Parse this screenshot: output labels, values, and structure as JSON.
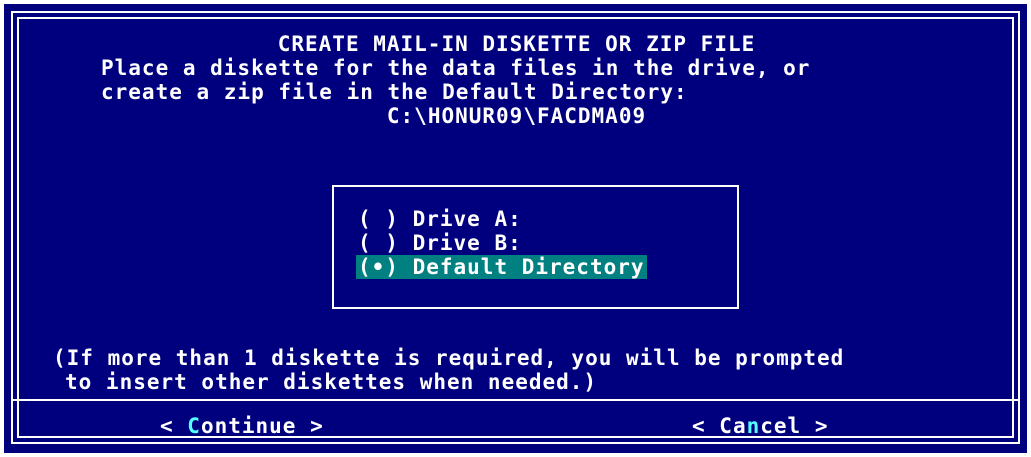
{
  "dialog": {
    "title": "CREATE MAIL-IN DISKETTE OR ZIP FILE",
    "instruction_line1": "Place a diskette for the data files in the drive, or",
    "instruction_line2": "create a zip file in the Default Directory:",
    "default_directory": "C:\\HONUR09\\FACDMA09",
    "options": [
      {
        "marker": "( )",
        "label": "Drive A:",
        "selected": false
      },
      {
        "marker": "( )",
        "label": "Drive B:",
        "selected": false
      },
      {
        "marker": "(•)",
        "label": "Default Directory",
        "selected": true
      }
    ],
    "note_line1": "(If more than 1 diskette is required, you will be prompted",
    "note_line2": "to insert other diskettes when needed.)"
  },
  "buttons": {
    "continue": {
      "open": "< ",
      "pre": "",
      "hotkey": "C",
      "post": "ontinue",
      "close": " >"
    },
    "cancel": {
      "open": "< ",
      "pre": "Ca",
      "hotkey": "n",
      "post": "cel",
      "close": " >"
    }
  },
  "colors": {
    "background": "#00007f",
    "text": "#ffffff",
    "highlight": "#008080",
    "hotkey": "#55ffff"
  }
}
